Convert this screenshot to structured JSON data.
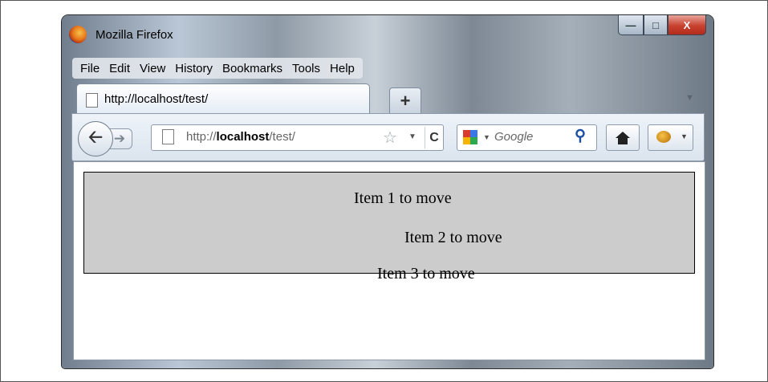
{
  "window": {
    "title": "Mozilla Firefox"
  },
  "caption_buttons": {
    "minimize": "—",
    "maximize": "□",
    "close": "X"
  },
  "menu": {
    "items": [
      "File",
      "Edit",
      "View",
      "History",
      "Bookmarks",
      "Tools",
      "Help"
    ]
  },
  "tabs": {
    "active_tab_label": "http://localhost/test/",
    "new_tab_label": "+"
  },
  "navigation": {
    "url_prefix": "http://",
    "url_host": "localhost",
    "url_path": "/test/",
    "search_placeholder": "Google"
  },
  "icons": [
    "firefox-logo-icon",
    "page-icon",
    "back-arrow-icon",
    "forward-arrow-icon",
    "star-icon",
    "reload-icon",
    "google-logo-icon",
    "search-icon",
    "home-icon",
    "firebug-icon"
  ],
  "colors": {
    "drop_area_background": "#cccccc",
    "close_button": "#c8412f"
  },
  "page": {
    "items": [
      "Item 1 to move",
      "Item 2 to move",
      "Item 3 to move"
    ]
  }
}
